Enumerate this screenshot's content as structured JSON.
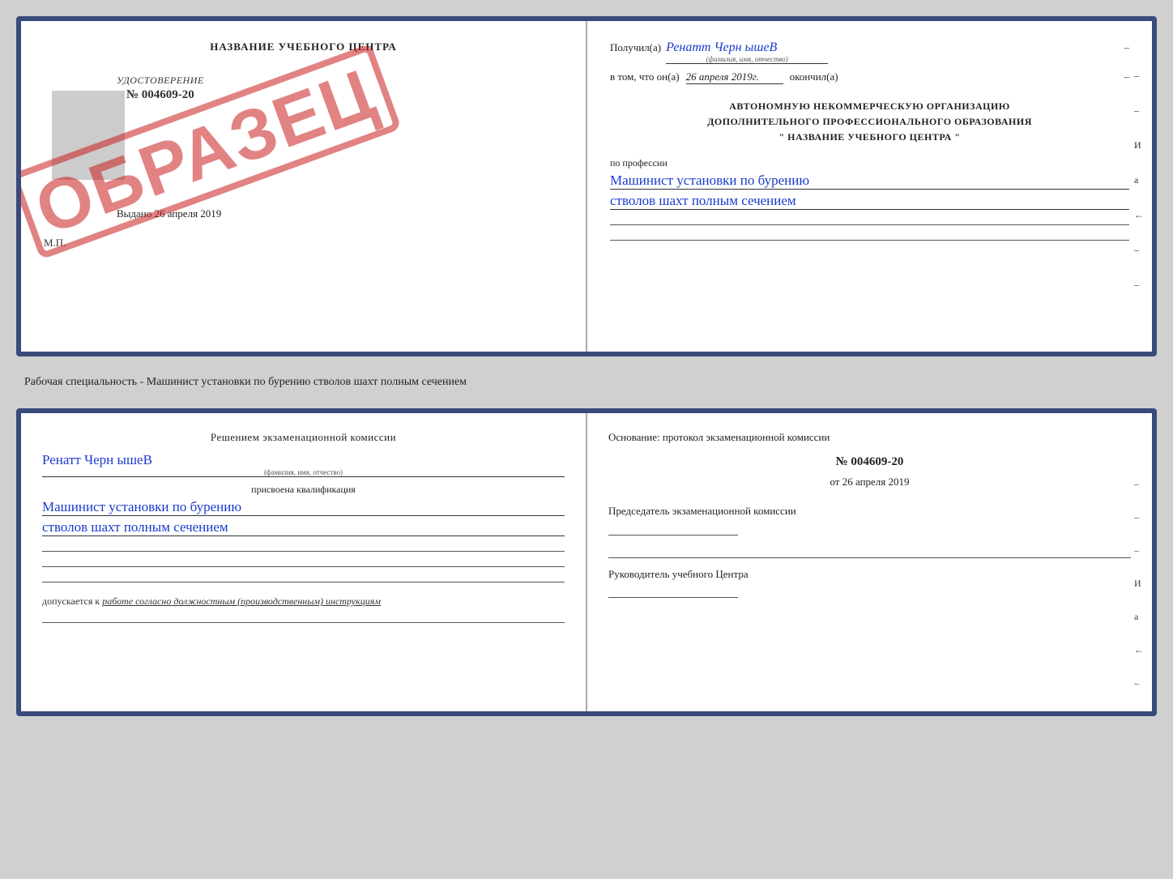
{
  "top_doc": {
    "left": {
      "title": "НАЗВАНИЕ УЧЕБНОГО ЦЕНТРА",
      "stamp": "ОБРАЗЕЦ",
      "udostoverenie_label": "УДОСТОВЕРЕНИЕ",
      "number": "№ 004609-20",
      "vydano_prefix": "Выдано",
      "vydano_date": "26 апреля 2019",
      "mp": "М.П."
    },
    "right": {
      "poluchil_label": "Получил(а)",
      "poluchil_name": "Ренатт Черн ышеВ",
      "fio_subtitle": "(фамилия, имя, отчество)",
      "dash": "–",
      "vtom_label": "в том, что он(а)",
      "vtom_date": "26 апреля 2019г.",
      "okochil_label": "окончил(а)",
      "autonomnaya_line1": "АВТОНОМНУЮ НЕКОММЕРЧЕСКУЮ ОРГАНИЗАЦИЮ",
      "autonomnaya_line2": "ДОПОЛНИТЕЛЬНОГО ПРОФЕССИОНАЛЬНОГО ОБРАЗОВАНИЯ",
      "autonomnaya_line3": "\"  НАЗВАНИЕ УЧЕБНОГО ЦЕНТРА  \"",
      "po_professii_label": "по профессии",
      "profession_line1": "Машинист установки по бурению",
      "profession_line2": "стволов шахт полным сечением"
    }
  },
  "middle": {
    "text": "Рабочая специальность - Машинист установки по бурению стволов шахт полным сечением"
  },
  "bottom_doc": {
    "left": {
      "resheniem_title": "Решением экзаменационной комиссии",
      "person_name": "Ренатт Черн ышеВ",
      "fio_subtitle": "(фамилия, имя, отчество)",
      "prisvoena_label": "присвоена квалификация",
      "qualification_line1": "Машинист установки по бурению",
      "qualification_line2": "стволов шахт полным сечением",
      "dopuskaetsya_prefix": "допускается к",
      "dopuskaetsya_italic": "работе согласно должностным (производственным) инструкциям"
    },
    "right": {
      "osnovanie_title": "Основание: протокол экзаменационной комиссии",
      "protocol_num": "№  004609-20",
      "protocol_date_prefix": "от",
      "protocol_date": "26 апреля 2019",
      "predsedatel_label": "Председатель экзаменационной комиссии",
      "rukovoditel_label": "Руководитель учебного Центра",
      "dashes": [
        "–",
        "–",
        "–",
        "И",
        "а",
        "←",
        "–",
        "–",
        "–"
      ]
    }
  }
}
